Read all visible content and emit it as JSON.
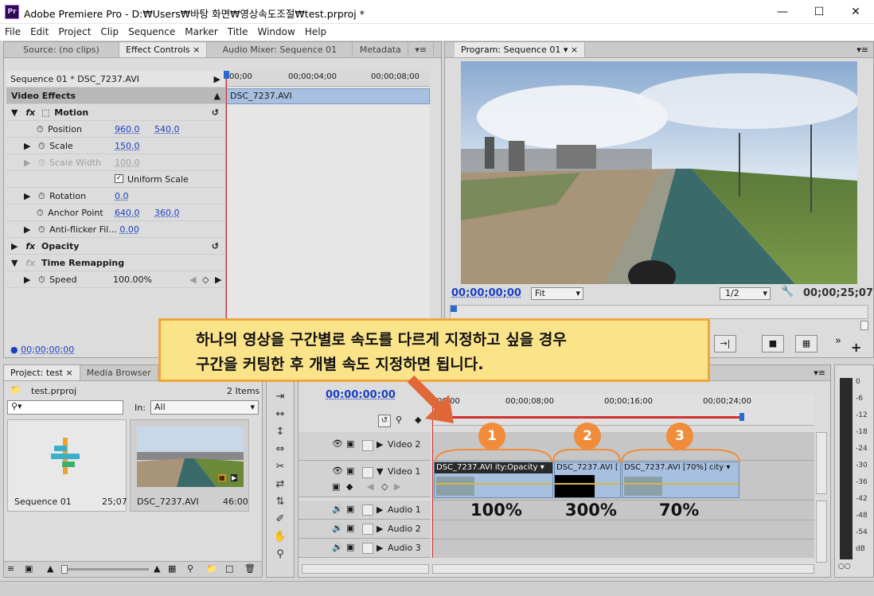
{
  "window": {
    "title": "Adobe Premiere Pro - D:₩Users₩바탕 화면₩영상속도조절₩test.prproj *",
    "app_icon": "Pr"
  },
  "menu": [
    "File",
    "Edit",
    "Project",
    "Clip",
    "Sequence",
    "Marker",
    "Title",
    "Window",
    "Help"
  ],
  "source_tabs": {
    "source": "Source: (no clips)",
    "effect_controls": "Effect Controls",
    "audio_mixer": "Audio Mixer: Sequence 01",
    "metadata": "Metadata"
  },
  "effect_controls": {
    "sequence_label": "Sequence 01 * DSC_7237.AVI",
    "ruler": [
      "00;00",
      "00;00;04;00",
      "00;00;08;00"
    ],
    "clip_label": "DSC_7237.AVI",
    "section": "Video Effects",
    "motion": "Motion",
    "position": {
      "label": "Position",
      "x": "960.0",
      "y": "540.0"
    },
    "scale": {
      "label": "Scale",
      "value": "150.0"
    },
    "scale_width": {
      "label": "Scale Width",
      "value": "100.0"
    },
    "uniform_scale": "Uniform Scale",
    "rotation": {
      "label": "Rotation",
      "value": "0.0"
    },
    "anchor_point": {
      "label": "Anchor Point",
      "x": "640.0",
      "y": "360.0"
    },
    "anti_flicker": {
      "label": "Anti-flicker Fil...",
      "value": "0.00"
    },
    "opacity": "Opacity",
    "time_remapping": "Time Remapping",
    "speed": {
      "label": "Speed",
      "value": "100.00%"
    },
    "timecode": "00;00;00;00"
  },
  "program": {
    "tab": "Program: Sequence 01",
    "timecode_left": "00;00;00;00",
    "fit": "Fit",
    "quality": "1/2",
    "timecode_right": "00;00;25;07"
  },
  "callout": {
    "line1": "하나의 영상을 구간별로 속도를 다르게 지정하고 싶을 경우",
    "line2": "구간을 커팅한 후 개별 속도 지정하면 됩니다."
  },
  "project": {
    "tabs": {
      "project": "Project: test",
      "media_browser": "Media Browser"
    },
    "file": "test.prproj",
    "items": "2 Items",
    "in_label": "In:",
    "in_value": "All",
    "bins": [
      {
        "name": "Sequence 01",
        "duration": "25;07"
      },
      {
        "name": "DSC_7237.AVI",
        "duration": "46:00"
      }
    ]
  },
  "timeline": {
    "timecode": "00:00:00:00",
    "ruler": [
      "00;00",
      "00;00;08;00",
      "00;00;16;00",
      "00;00;24;00"
    ],
    "tracks": {
      "video2": "Video 2",
      "video1": "Video 1",
      "audio1": "Audio 1",
      "audio2": "Audio 2",
      "audio3": "Audio 3"
    },
    "clips": [
      {
        "label": "DSC_7237.AVI",
        "fx": "ity:Opacity"
      },
      {
        "label": "DSC_7237.AVI ["
      },
      {
        "label": "DSC_7237.AVI [70%]",
        "fx": "city"
      }
    ],
    "markers": [
      "1",
      "2",
      "3"
    ],
    "speeds": [
      "100%",
      "300%",
      "70%"
    ]
  },
  "meter": {
    "labels": [
      "0",
      "-6",
      "-12",
      "-18",
      "-24",
      "-30",
      "-36",
      "-42",
      "-48",
      "-54",
      "dB"
    ]
  },
  "colors": {
    "accent_orange": "#f08c3a",
    "callout_bg": "#fbe38a",
    "callout_border": "#f0a63a",
    "link_blue": "#1c3fc0",
    "playhead": "#d03030"
  }
}
